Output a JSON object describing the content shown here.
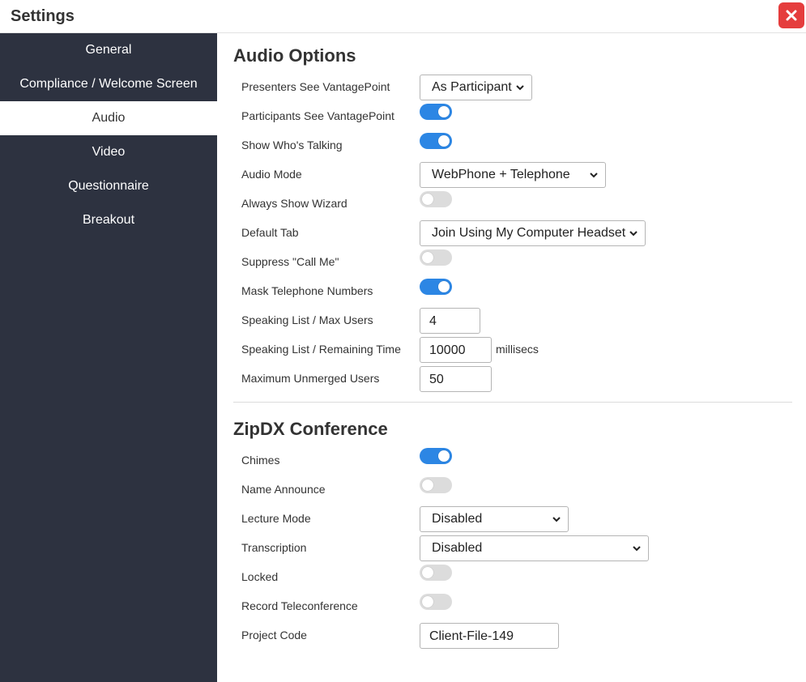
{
  "window": {
    "title": "Settings",
    "close_icon": "close-icon"
  },
  "sidebar": {
    "items": [
      {
        "label": "General",
        "active": false
      },
      {
        "label": "Compliance / Welcome Screen",
        "active": false
      },
      {
        "label": "Audio",
        "active": true
      },
      {
        "label": "Video",
        "active": false
      },
      {
        "label": "Questionnaire",
        "active": false
      },
      {
        "label": "Breakout",
        "active": false
      }
    ]
  },
  "audio_options": {
    "title": "Audio Options",
    "presenters_see_vantagepoint": {
      "label": "Presenters See VantagePoint",
      "value": "As Participant"
    },
    "participants_see_vantagepoint": {
      "label": "Participants See VantagePoint",
      "on": true
    },
    "show_whos_talking": {
      "label": "Show Who's Talking",
      "on": true
    },
    "audio_mode": {
      "label": "Audio Mode",
      "value": "WebPhone + Telephone"
    },
    "always_show_wizard": {
      "label": "Always Show Wizard",
      "on": false
    },
    "default_tab": {
      "label": "Default Tab",
      "value": "Join Using My Computer Headset"
    },
    "suppress_call_me": {
      "label": "Suppress \"Call Me\"",
      "on": false
    },
    "mask_telephone_numbers": {
      "label": "Mask Telephone Numbers",
      "on": true
    },
    "speaking_list_max_users": {
      "label": "Speaking List / Max Users",
      "value": "4"
    },
    "speaking_list_remaining_time": {
      "label": "Speaking List / Remaining Time",
      "value": "10000",
      "suffix": "millisecs"
    },
    "maximum_unmerged_users": {
      "label": "Maximum Unmerged Users",
      "value": "50"
    }
  },
  "zipdx_conference": {
    "title": "ZipDX Conference",
    "chimes": {
      "label": "Chimes",
      "on": true
    },
    "name_announce": {
      "label": "Name Announce",
      "on": false
    },
    "lecture_mode": {
      "label": "Lecture Mode",
      "value": "Disabled"
    },
    "transcription": {
      "label": "Transcription",
      "value": "Disabled"
    },
    "locked": {
      "label": "Locked",
      "on": false
    },
    "record_teleconference": {
      "label": "Record Teleconference",
      "on": false
    },
    "project_code": {
      "label": "Project Code",
      "value": "Client-File-149"
    }
  },
  "colors": {
    "sidebar_bg": "#2d3240",
    "toggle_on": "#2c86e4",
    "toggle_off": "#dcdcdc",
    "close_bg": "#e53d3d"
  }
}
